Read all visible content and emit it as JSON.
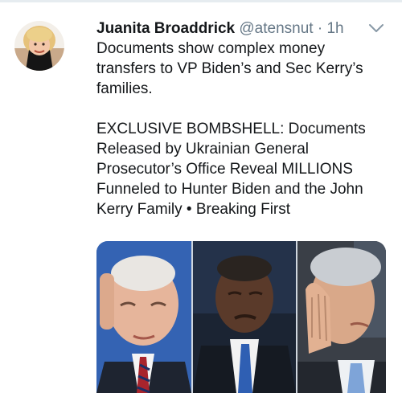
{
  "tweet": {
    "author_name": "Juanita Broaddrick",
    "author_handle": "@atensnut",
    "separator": "·",
    "timestamp": "1h",
    "text_lines": [
      "Documents show complex money",
      "transfers to VP Biden’s and Sec Kerry’s",
      "families."
    ],
    "card_lines": [
      "EXCLUSIVE BOMBSHELL: Documents",
      "Released by Ukrainian General",
      "Prosecutor’s Office Reveal MILLIONS",
      "Funneled to Hunter Biden and the John",
      "Kerry Family • Breaking First"
    ],
    "media_panels": 3
  },
  "icons": {
    "avatar": "avatar-photo",
    "menu": "chevron-down-icon"
  },
  "colors": {
    "text": "#14171a",
    "secondary": "#657786",
    "divider": "#e6ecf0",
    "media_bg_left": "#2d5aa8",
    "media_bg_mid": "#1b2433",
    "media_bg_right": "#3a3f47"
  }
}
